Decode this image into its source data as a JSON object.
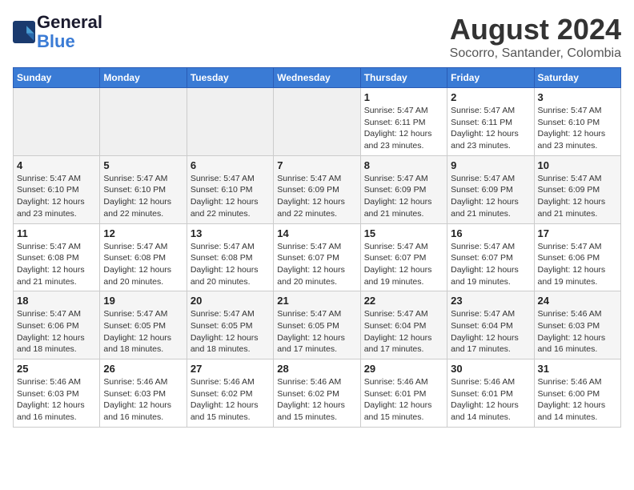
{
  "header": {
    "logo_general": "General",
    "logo_blue": "Blue",
    "title": "August 2024",
    "subtitle": "Socorro, Santander, Colombia"
  },
  "weekdays": [
    "Sunday",
    "Monday",
    "Tuesday",
    "Wednesday",
    "Thursday",
    "Friday",
    "Saturday"
  ],
  "weeks": [
    [
      {
        "day": "",
        "info": ""
      },
      {
        "day": "",
        "info": ""
      },
      {
        "day": "",
        "info": ""
      },
      {
        "day": "",
        "info": ""
      },
      {
        "day": "1",
        "info": "Sunrise: 5:47 AM\nSunset: 6:11 PM\nDaylight: 12 hours\nand 23 minutes."
      },
      {
        "day": "2",
        "info": "Sunrise: 5:47 AM\nSunset: 6:11 PM\nDaylight: 12 hours\nand 23 minutes."
      },
      {
        "day": "3",
        "info": "Sunrise: 5:47 AM\nSunset: 6:10 PM\nDaylight: 12 hours\nand 23 minutes."
      }
    ],
    [
      {
        "day": "4",
        "info": "Sunrise: 5:47 AM\nSunset: 6:10 PM\nDaylight: 12 hours\nand 23 minutes."
      },
      {
        "day": "5",
        "info": "Sunrise: 5:47 AM\nSunset: 6:10 PM\nDaylight: 12 hours\nand 22 minutes."
      },
      {
        "day": "6",
        "info": "Sunrise: 5:47 AM\nSunset: 6:10 PM\nDaylight: 12 hours\nand 22 minutes."
      },
      {
        "day": "7",
        "info": "Sunrise: 5:47 AM\nSunset: 6:09 PM\nDaylight: 12 hours\nand 22 minutes."
      },
      {
        "day": "8",
        "info": "Sunrise: 5:47 AM\nSunset: 6:09 PM\nDaylight: 12 hours\nand 21 minutes."
      },
      {
        "day": "9",
        "info": "Sunrise: 5:47 AM\nSunset: 6:09 PM\nDaylight: 12 hours\nand 21 minutes."
      },
      {
        "day": "10",
        "info": "Sunrise: 5:47 AM\nSunset: 6:09 PM\nDaylight: 12 hours\nand 21 minutes."
      }
    ],
    [
      {
        "day": "11",
        "info": "Sunrise: 5:47 AM\nSunset: 6:08 PM\nDaylight: 12 hours\nand 21 minutes."
      },
      {
        "day": "12",
        "info": "Sunrise: 5:47 AM\nSunset: 6:08 PM\nDaylight: 12 hours\nand 20 minutes."
      },
      {
        "day": "13",
        "info": "Sunrise: 5:47 AM\nSunset: 6:08 PM\nDaylight: 12 hours\nand 20 minutes."
      },
      {
        "day": "14",
        "info": "Sunrise: 5:47 AM\nSunset: 6:07 PM\nDaylight: 12 hours\nand 20 minutes."
      },
      {
        "day": "15",
        "info": "Sunrise: 5:47 AM\nSunset: 6:07 PM\nDaylight: 12 hours\nand 19 minutes."
      },
      {
        "day": "16",
        "info": "Sunrise: 5:47 AM\nSunset: 6:07 PM\nDaylight: 12 hours\nand 19 minutes."
      },
      {
        "day": "17",
        "info": "Sunrise: 5:47 AM\nSunset: 6:06 PM\nDaylight: 12 hours\nand 19 minutes."
      }
    ],
    [
      {
        "day": "18",
        "info": "Sunrise: 5:47 AM\nSunset: 6:06 PM\nDaylight: 12 hours\nand 18 minutes."
      },
      {
        "day": "19",
        "info": "Sunrise: 5:47 AM\nSunset: 6:05 PM\nDaylight: 12 hours\nand 18 minutes."
      },
      {
        "day": "20",
        "info": "Sunrise: 5:47 AM\nSunset: 6:05 PM\nDaylight: 12 hours\nand 18 minutes."
      },
      {
        "day": "21",
        "info": "Sunrise: 5:47 AM\nSunset: 6:05 PM\nDaylight: 12 hours\nand 17 minutes."
      },
      {
        "day": "22",
        "info": "Sunrise: 5:47 AM\nSunset: 6:04 PM\nDaylight: 12 hours\nand 17 minutes."
      },
      {
        "day": "23",
        "info": "Sunrise: 5:47 AM\nSunset: 6:04 PM\nDaylight: 12 hours\nand 17 minutes."
      },
      {
        "day": "24",
        "info": "Sunrise: 5:46 AM\nSunset: 6:03 PM\nDaylight: 12 hours\nand 16 minutes."
      }
    ],
    [
      {
        "day": "25",
        "info": "Sunrise: 5:46 AM\nSunset: 6:03 PM\nDaylight: 12 hours\nand 16 minutes."
      },
      {
        "day": "26",
        "info": "Sunrise: 5:46 AM\nSunset: 6:03 PM\nDaylight: 12 hours\nand 16 minutes."
      },
      {
        "day": "27",
        "info": "Sunrise: 5:46 AM\nSunset: 6:02 PM\nDaylight: 12 hours\nand 15 minutes."
      },
      {
        "day": "28",
        "info": "Sunrise: 5:46 AM\nSunset: 6:02 PM\nDaylight: 12 hours\nand 15 minutes."
      },
      {
        "day": "29",
        "info": "Sunrise: 5:46 AM\nSunset: 6:01 PM\nDaylight: 12 hours\nand 15 minutes."
      },
      {
        "day": "30",
        "info": "Sunrise: 5:46 AM\nSunset: 6:01 PM\nDaylight: 12 hours\nand 14 minutes."
      },
      {
        "day": "31",
        "info": "Sunrise: 5:46 AM\nSunset: 6:00 PM\nDaylight: 12 hours\nand 14 minutes."
      }
    ]
  ]
}
